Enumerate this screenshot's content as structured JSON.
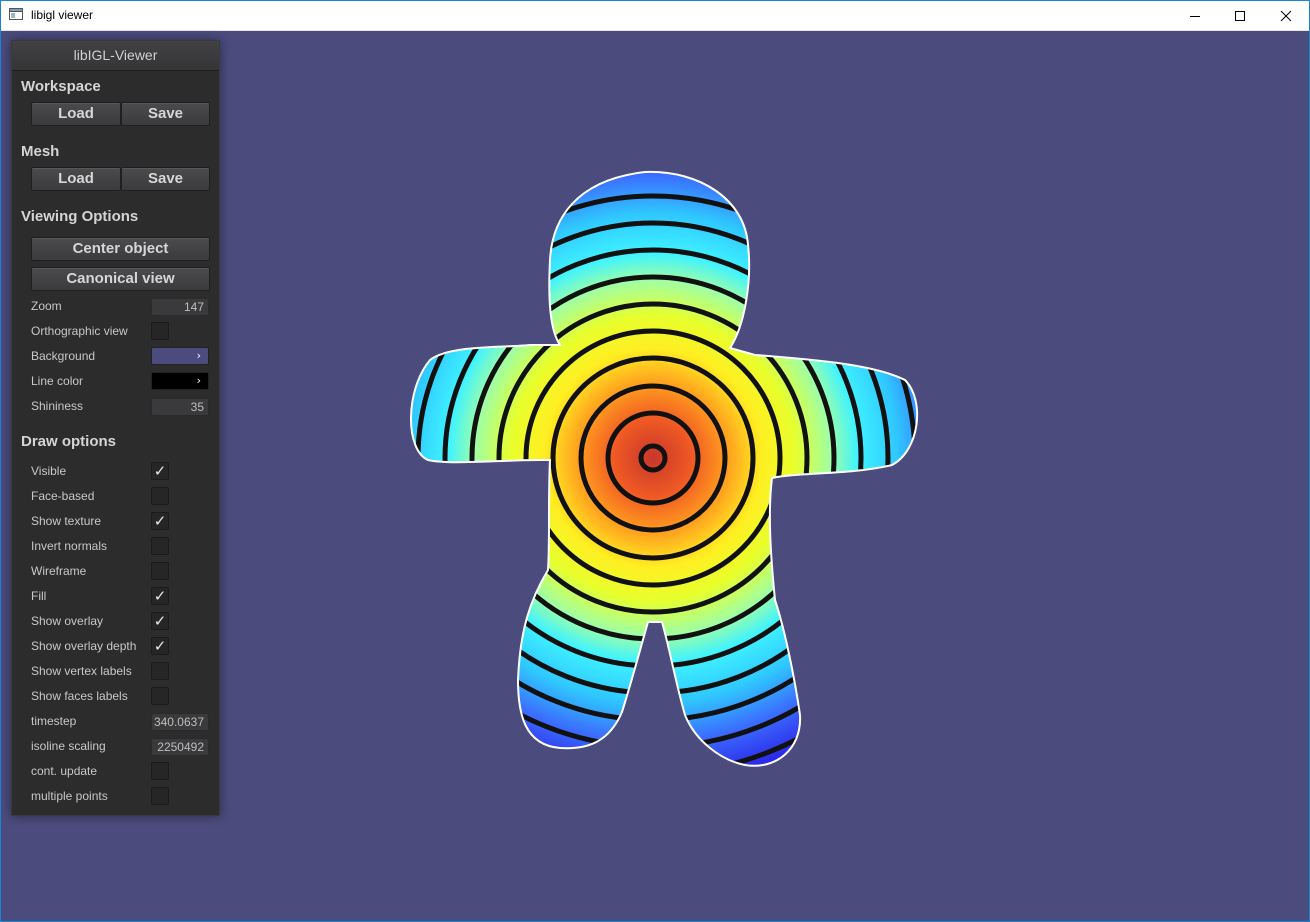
{
  "window": {
    "title": "libigl viewer",
    "icon": "app-window-icon",
    "controls": [
      "minimize-icon",
      "maximize-icon",
      "close-icon"
    ]
  },
  "colors": {
    "background": "#4b4c7d",
    "panel": "#2c2c2d",
    "line_color": "#000000"
  },
  "panel": {
    "title": "libIGL-Viewer",
    "workspace": {
      "heading": "Workspace",
      "load": "Load",
      "save": "Save"
    },
    "mesh": {
      "heading": "Mesh",
      "load": "Load",
      "save": "Save"
    },
    "viewing": {
      "heading": "Viewing Options",
      "center_object": "Center object",
      "canonical_view": "Canonical view",
      "zoom_label": "Zoom",
      "zoom_value": "147",
      "ortho_label": "Orthographic view",
      "ortho_checked": false,
      "background_label": "Background",
      "line_color_label": "Line color",
      "shininess_label": "Shininess",
      "shininess_value": "35"
    },
    "draw": {
      "heading": "Draw options",
      "options": [
        {
          "label": "Visible",
          "checked": true
        },
        {
          "label": "Face-based",
          "checked": false
        },
        {
          "label": "Show texture",
          "checked": true
        },
        {
          "label": "Invert normals",
          "checked": false
        },
        {
          "label": "Wireframe",
          "checked": false
        },
        {
          "label": "Fill",
          "checked": true
        },
        {
          "label": "Show overlay",
          "checked": true
        },
        {
          "label": "Show overlay depth",
          "checked": true
        },
        {
          "label": "Show vertex labels",
          "checked": false
        },
        {
          "label": "Show faces labels",
          "checked": false
        }
      ],
      "timestep_label": "timestep",
      "timestep_value": "340.0637",
      "isoline_label": "isoline scaling",
      "isoline_value": "2250492",
      "cont_update_label": "cont. update",
      "cont_update_checked": false,
      "multiple_points_label": "multiple points",
      "multiple_points_checked": false
    }
  }
}
